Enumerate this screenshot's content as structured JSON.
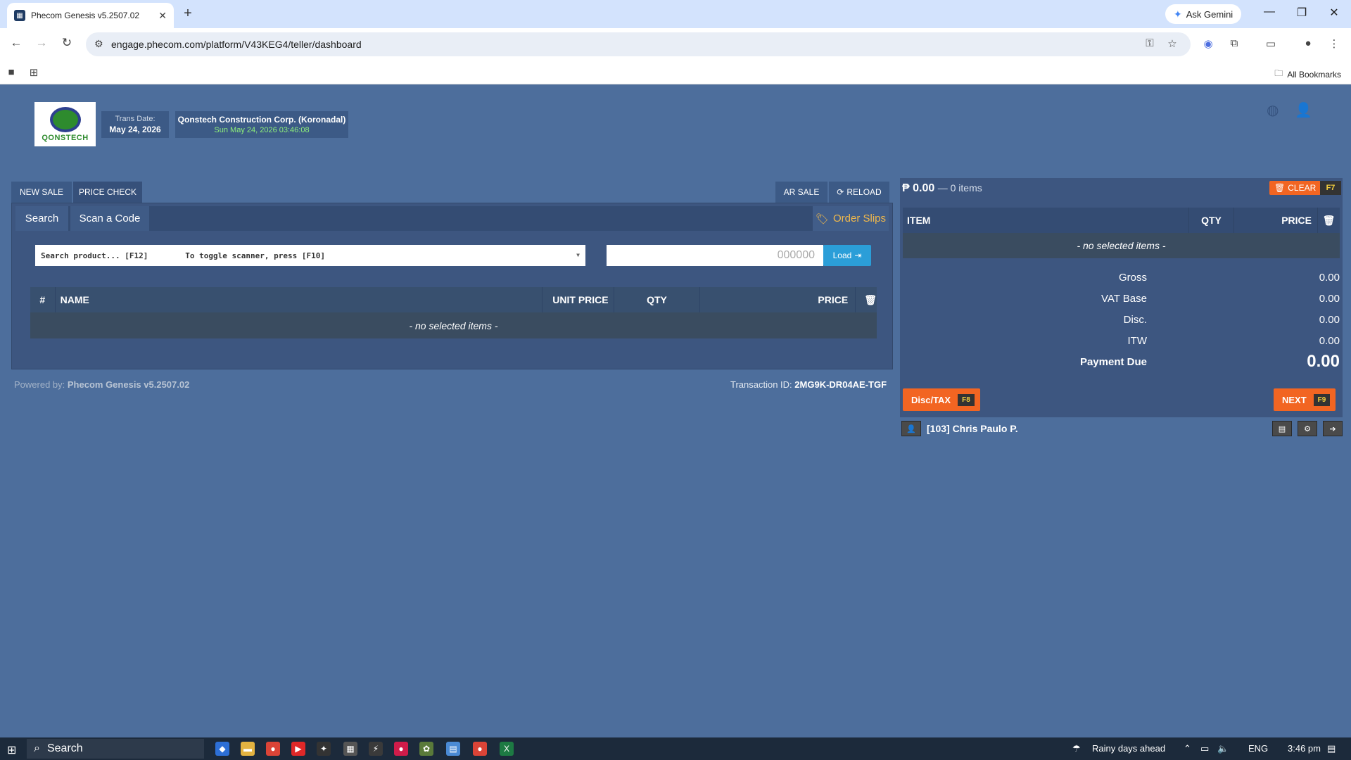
{
  "browser": {
    "tab_title": "Phecom Genesis v5.2507.02",
    "url": "engage.phecom.com/platform/V43KEG4/teller/dashboard",
    "ask_gemini": "Ask Gemini",
    "all_bookmarks": "All Bookmarks"
  },
  "header": {
    "logo_text": "QONSTECH",
    "trans_date_label": "Trans Date:",
    "trans_date_value": "May 24, 2026",
    "company_name": "Qonstech Construction Corp. (Koronadal)",
    "datetime": "Sun May 24, 2026 03:46:08"
  },
  "left": {
    "tabs": {
      "new_sale": "NEW SALE",
      "price_check": "PRICE CHECK",
      "ar_sale": "AR SALE",
      "reload": "RELOAD"
    },
    "subtabs": {
      "search": "Search",
      "scan": "Scan a Code",
      "order_slips": "Order Slips"
    },
    "search_placeholder": "Search product... [F12]        To toggle scanner, press [F10]",
    "code_placeholder": "000000",
    "load_label": "Load",
    "columns": {
      "num": "#",
      "name": "NAME",
      "unit_price": "UNIT PRICE",
      "qty": "QTY",
      "price": "PRICE"
    },
    "empty_text": "- no selected items -"
  },
  "footer": {
    "powered_label": "Powered by:",
    "powered_value": "Phecom Genesis v5.2507.02",
    "txid_label": "Transaction ID:",
    "txid_value": "2MG9K-DR04AE-TGF"
  },
  "cart": {
    "total": "₱ 0.00",
    "items_count": "— 0 items",
    "clear_label": "CLEAR",
    "clear_key": "F7",
    "columns": {
      "item": "ITEM",
      "qty": "QTY",
      "price": "PRICE"
    },
    "empty_text": "- no selected items -",
    "summary": [
      {
        "label": "Gross",
        "value": "0.00"
      },
      {
        "label": "VAT Base",
        "value": "0.00"
      },
      {
        "label": "Disc.",
        "value": "0.00"
      },
      {
        "label": "ITW",
        "value": "0.00"
      }
    ],
    "due_label": "Payment Due",
    "due_value": "0.00",
    "disc_label": "Disc/TAX",
    "disc_key": "F8",
    "next_label": "NEXT",
    "next_key": "F9",
    "user": "[103] Chris Paulo P."
  },
  "taskbar": {
    "search": "Search",
    "weather": "Rainy days ahead",
    "lang": "ENG",
    "time": "3:46 pm"
  }
}
